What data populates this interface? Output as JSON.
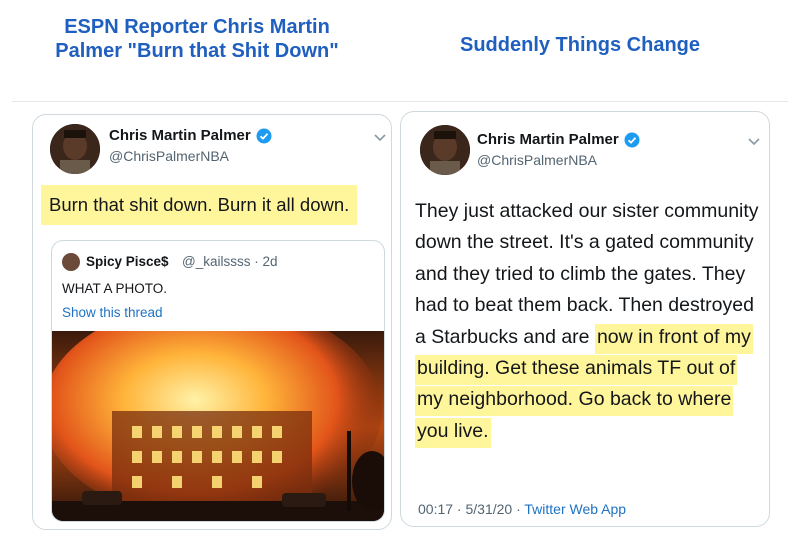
{
  "captions": {
    "left": "ESPN Reporter Chris Martin Palmer \"Burn that Shit Down\"",
    "right": "Suddenly Things Change"
  },
  "tweet_left": {
    "name": "Chris Martin Palmer",
    "handle": "@ChrisPalmerNBA",
    "text": "Burn that shit down. Burn it all down.",
    "quoted": {
      "name": "Spicy Pisce$",
      "handle": "@_kailssss · 2d",
      "text": "WHAT A PHOTO.",
      "link": "Show this thread"
    }
  },
  "tweet_right": {
    "name": "Chris Martin Palmer",
    "handle": "@ChrisPalmerNBA",
    "text_plain": "They just attacked our sister community down the street. It's a gated community and they tried to climb the gates. They had to beat them back. Then destroyed a Starbucks and are ",
    "text_highlight": "now in front of my building. Get these animals TF out of my neighborhood. Go back to where you live.",
    "time": "00:17 · 5/31/20 · ",
    "app": "Twitter Web App"
  },
  "colors": {
    "caption": "#1f5fbf",
    "highlight": "#fff59a",
    "link": "#1d72c4",
    "verified": "#1d9bf0"
  }
}
